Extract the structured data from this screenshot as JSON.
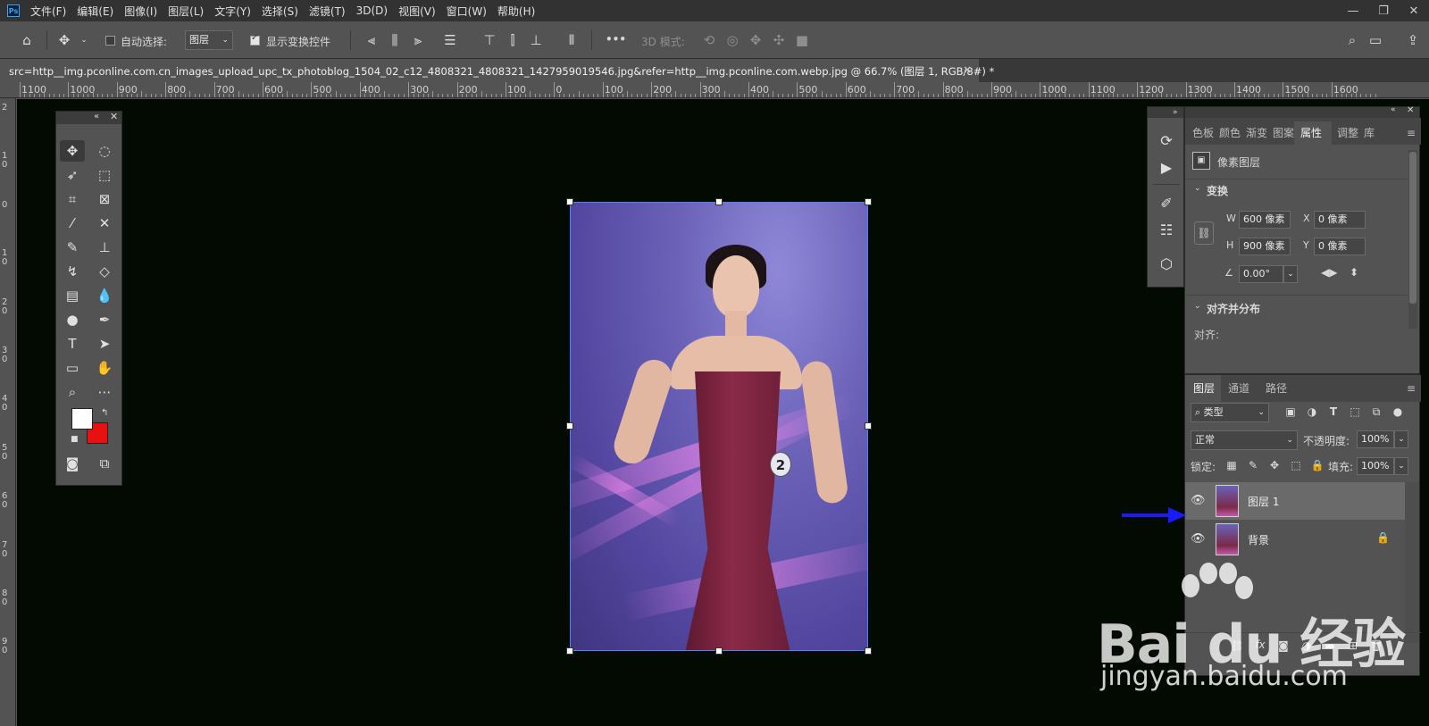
{
  "app": {
    "logo_text": "Ps",
    "menu": [
      "文件(F)",
      "编辑(E)",
      "图像(I)",
      "图层(L)",
      "文字(Y)",
      "选择(S)",
      "滤镜(T)",
      "3D(D)",
      "视图(V)",
      "窗口(W)",
      "帮助(H)"
    ]
  },
  "options_bar": {
    "auto_select_label": "自动选择:",
    "auto_select_target": "图层",
    "show_transform_label": "显示变换控件",
    "mode_3d_label": "3D 模式:",
    "more": "•••"
  },
  "document": {
    "tab_title": "src=http__img.pconline.com.cn_images_upload_upc_tx_photoblog_1504_02_c12_4808321_4808321_1427959019546.jpg&refer=http__img.pconline.com.webp.jpg @ 66.7% (图层 1, RGB/8#) *",
    "close": "×"
  },
  "ruler_top": [
    "1100",
    "1000",
    "900",
    "800",
    "700",
    "600",
    "500",
    "400",
    "300",
    "200",
    "100",
    "0",
    "100",
    "200",
    "300",
    "400",
    "500",
    "600",
    "700",
    "800",
    "900",
    "1000",
    "1100",
    "1200",
    "1300",
    "1400",
    "1500",
    "1600"
  ],
  "ruler_left": [
    "2",
    "1\n0",
    "0",
    "1\n0",
    "2\n0",
    "3\n0",
    "4\n0",
    "5\n0",
    "6\n0",
    "7\n0",
    "8\n0",
    "9\n0"
  ],
  "canvas_image": {
    "number_tag": "2"
  },
  "properties_panel": {
    "tabs": [
      "色板",
      "颜色",
      "渐变",
      "图案",
      "属性",
      "调整",
      "库"
    ],
    "active_tab": "属性",
    "layer_kind": "像素图层",
    "transform_header": "变换",
    "w_label": "W",
    "w_value": "600 像素",
    "h_label": "H",
    "h_value": "900 像素",
    "x_label": "X",
    "x_value": "0 像素",
    "y_label": "Y",
    "y_value": "0 像素",
    "angle_value": "0.00°",
    "align_header": "对齐并分布",
    "align_label": "对齐:"
  },
  "layers_panel": {
    "tabs": [
      "图层",
      "通道",
      "路径"
    ],
    "active_tab": "图层",
    "filter_kind": "类型",
    "blend_mode": "正常",
    "opacity_label": "不透明度:",
    "opacity_value": "100%",
    "lock_label": "锁定:",
    "fill_label": "填充:",
    "fill_value": "100%",
    "layers": [
      {
        "name": "图层 1",
        "selected": true
      },
      {
        "name": "背景",
        "selected": false,
        "locked": true
      }
    ],
    "footer_fx": "fx"
  },
  "colors": {
    "foreground": "#ffffff",
    "background": "#e81010",
    "selection_accent": "#4a82ff",
    "arrow": "#1a1aff"
  },
  "watermark": {
    "logo": "Bai du 经验",
    "url": "jingyan.baidu.com"
  }
}
